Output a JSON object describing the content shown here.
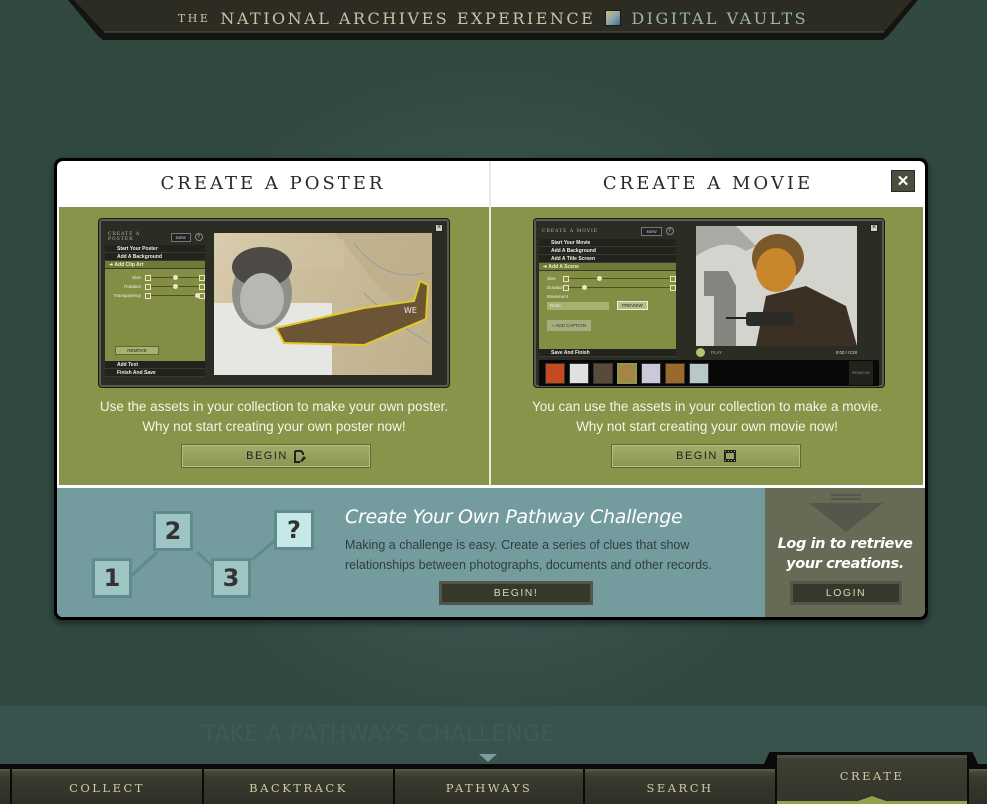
{
  "header": {
    "prefix": "THE",
    "title": "NATIONAL ARCHIVES EXPERIENCE",
    "logo_icon": "digital-vaults-logo-icon",
    "subtitle": "DIGITAL VAULTS"
  },
  "modal": {
    "close_icon": "close-icon",
    "close_label": "✕",
    "poster": {
      "title": "CREATE A POSTER",
      "preview": {
        "app_title": "CREATE A POSTER",
        "new_label": "NEW",
        "help_label": "?",
        "steps": [
          "Start Your Poster",
          "Add A Background",
          "Add Clip Art"
        ],
        "active_step": "Add Clip Art",
        "controls": [
          "Size",
          "Rotation",
          "Transparency"
        ],
        "control_values": [
          0.5,
          0.5,
          0.95
        ],
        "remove_label": "REMOVE",
        "steps_after": [
          "Add Text",
          "Finish And Save"
        ],
        "plane_marking": "WE"
      },
      "description_line1": "Use the assets in your collection to make your own poster.",
      "description_line2": "Why not start creating your own poster now!",
      "begin_label": "BEGIN",
      "begin_icon": "edit-document-icon"
    },
    "movie": {
      "title": "CREATE A MOVIE",
      "preview": {
        "app_title": "CREATE A MOVIE",
        "new_label": "NEW",
        "help_label": "?",
        "steps": [
          "Start Your Movie",
          "Add A Background",
          "Add A Title Screen",
          "Add A Scene"
        ],
        "active_step": "Add A Scene",
        "controls": [
          "Size",
          "Duration"
        ],
        "control_values": [
          0.3,
          0.15
        ],
        "movement_label": "Movement",
        "movement_value": "None",
        "preview_label": "PREVIEW",
        "add_caption_label": "+ ADD CAPTION",
        "steps_after": [
          "Save And Finish"
        ],
        "play_label": "PLAY",
        "time": "0:00 / 0:28",
        "remove_label": "REMOVE",
        "thumbnail_count": 7
      },
      "description_line1": "You can use the assets in your collection to make a movie.",
      "description_line2": "Why not start creating your own movie now!",
      "begin_label": "BEGIN",
      "begin_icon": "film-icon"
    },
    "challenge": {
      "nodes": [
        "1",
        "2",
        "3",
        "?"
      ],
      "title": "Create Your Own Pathway Challenge",
      "description": "Making a challenge is easy. Create a series of clues that show relationships between photographs, documents and other records.",
      "begin_label": "BEGIN!"
    },
    "login": {
      "arrow_icon": "down-arrow-icon",
      "text": "Log in to retrieve your creations.",
      "button_label": "LOGIN"
    }
  },
  "background": {
    "ghost_text": "TAKE A PATHWAYS CHALLENGE"
  },
  "nav": {
    "tabs": [
      {
        "label": "COLLECT"
      },
      {
        "label": "BACKTRACK"
      },
      {
        "label": "PATHWAYS"
      },
      {
        "label": "SEARCH"
      },
      {
        "label": "CREATE",
        "active": true
      }
    ]
  },
  "colors": {
    "panel_green": "#889449",
    "challenge_teal": "#749c9f",
    "login_olive": "#686a55",
    "active_accent": "#92a24a"
  }
}
